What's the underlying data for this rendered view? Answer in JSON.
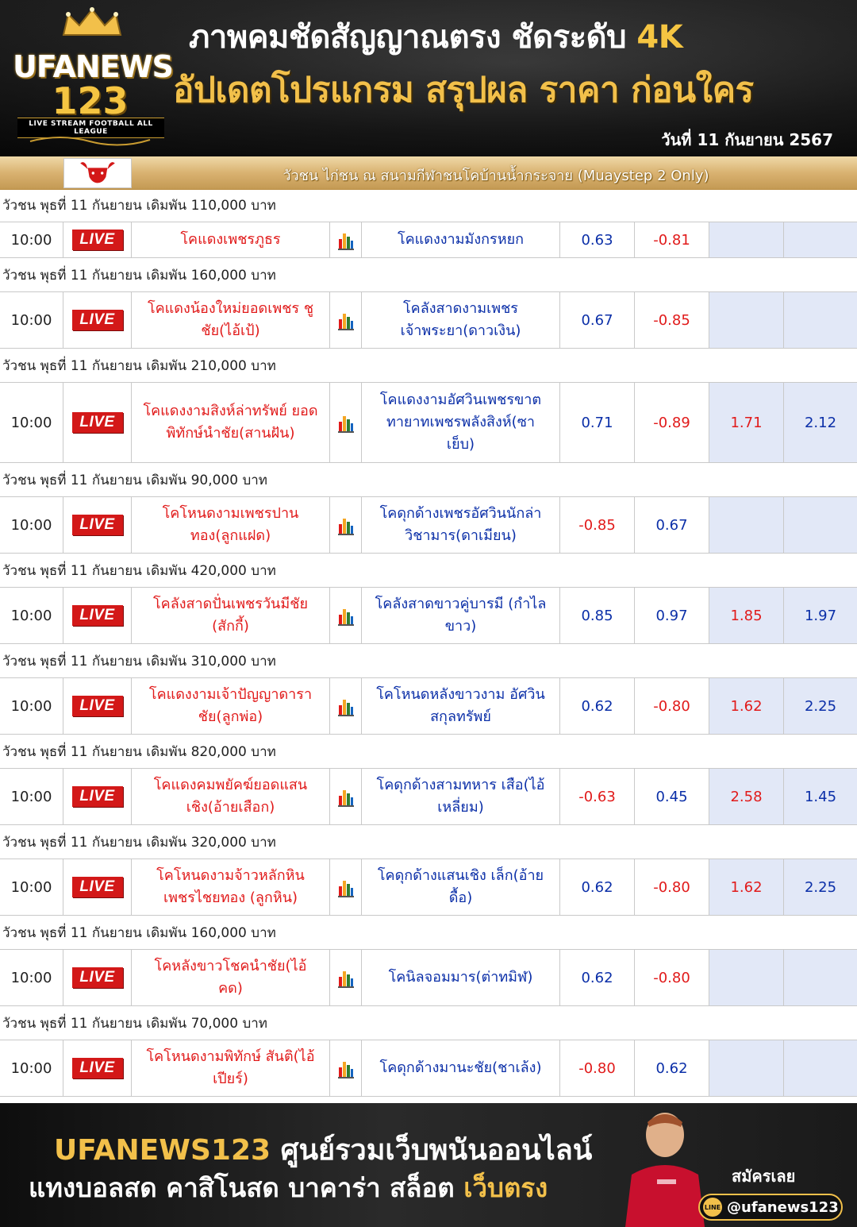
{
  "header": {
    "logo_brand": "UFANEWS",
    "logo_number": "123",
    "logo_tagline": "LIVE STREAM FOOTBALL ALL LEAGUE",
    "headline1_main": "ภาพคมชัดสัญญาณตรง ชัดระดับ ",
    "headline1_highlight": "4K",
    "headline2": "อัปเดตโปรแกรม สรุปผล ราคา ก่อนใคร",
    "date": "วันที่ 11 กันยายน 2567"
  },
  "league": {
    "title": "วัวชน ไก่ชน ณ สนามกีฬาชนโคบ้านน้ำกระจาย (Muaystep 2 Only)"
  },
  "matches": [
    {
      "group": "วัวชน พุธที่ 11 กันยายน เดิมพัน 110,000 บาท",
      "time": "10:00",
      "live": "LIVE",
      "home": "โคแดงเพชรภูธร",
      "away": "โคแดงงามมังกรหยก",
      "o1": "0.63",
      "o2": "-0.81",
      "o3": "",
      "o4": ""
    },
    {
      "group": "วัวชน พุธที่ 11 กันยายน เดิมพัน 160,000 บาท",
      "time": "10:00",
      "live": "LIVE",
      "home": "โคแดงน้องใหม่ยอดเพชร ชูชัย(ไอ้เป้)",
      "away": "โคลังสาดงามเพชร เจ้าพระยา(ดาวเงิน)",
      "o1": "0.67",
      "o2": "-0.85",
      "o3": "",
      "o4": ""
    },
    {
      "group": "วัวชน พุธที่ 11 กันยายน เดิมพัน 210,000 บาท",
      "time": "10:00",
      "live": "LIVE",
      "home": "โคแดงงามสิงห์ล่าทรัพย์ ยอดพิทักษ์นำชัย(สานฝัน)",
      "away": "โคแดงงามอัศวินเพชรขาต ทายาทเพชรพลังสิงห์(ซา เย็บ)",
      "o1": "0.71",
      "o2": "-0.89",
      "o3": "1.71",
      "o4": "2.12"
    },
    {
      "group": "วัวชน พุธที่ 11 กันยายน เดิมพัน 90,000 บาท",
      "time": "10:00",
      "live": "LIVE",
      "home": "โคโหนดงามเพชรปาน ทอง(ลูกแฝด)",
      "away": "โคดุกด้างเพชรอัศวินนักล่า วิชามาร(ดาเมียน)",
      "o1": "-0.85",
      "o2": "0.67",
      "o3": "",
      "o4": ""
    },
    {
      "group": "วัวชน พุธที่ 11 กันยายน เดิมพัน 420,000 บาท",
      "time": "10:00",
      "live": "LIVE",
      "home": "โคลังสาดปั่นเพชรวันมีชัย (สักกี้)",
      "away": "โคลังสาดขาวคู่บารมี (กำไลขาว)",
      "o1": "0.85",
      "o2": "0.97",
      "o3": "1.85",
      "o4": "1.97"
    },
    {
      "group": "วัวชน พุธที่ 11 กันยายน เดิมพัน 310,000 บาท",
      "time": "10:00",
      "live": "LIVE",
      "home": "โคแดงงามเจ้าปัญญาดารา ชัย(ลูกพ่อ)",
      "away": "โคโหนดหลังขาวงาม อัศวินสกุลทรัพย์",
      "o1": "0.62",
      "o2": "-0.80",
      "o3": "1.62",
      "o4": "2.25"
    },
    {
      "group": "วัวชน พุธที่ 11 กันยายน เดิมพัน 820,000 บาท",
      "time": "10:00",
      "live": "LIVE",
      "home": "โคแดงคมพยัคฆ์ยอดแสน เชิง(อ้ายเสือก)",
      "away": "โคดุกด้างสามทหาร เสือ(ไอ้เหลี่ยม)",
      "o1": "-0.63",
      "o2": "0.45",
      "o3": "2.58",
      "o4": "1.45"
    },
    {
      "group": "วัวชน พุธที่ 11 กันยายน เดิมพัน 320,000 บาท",
      "time": "10:00",
      "live": "LIVE",
      "home": "โคโหนดงามจ้าวหลักหิน เพชรไชยทอง (ลูกหิน)",
      "away": "โคดุกด้างแสนเชิง เล็ก(อ้ายดื้อ)",
      "o1": "0.62",
      "o2": "-0.80",
      "o3": "1.62",
      "o4": "2.25"
    },
    {
      "group": "วัวชน พุธที่ 11 กันยายน เดิมพัน 160,000 บาท",
      "time": "10:00",
      "live": "LIVE",
      "home": "โคหลังขาวโชคนำชัย(ไอ้ คด)",
      "away": "โคนิลจอมมาร(ต่าทมิฬ)",
      "o1": "0.62",
      "o2": "-0.80",
      "o3": "",
      "o4": ""
    },
    {
      "group": "วัวชน พุธที่ 11 กันยายน เดิมพัน 70,000 บาท",
      "time": "10:00",
      "live": "LIVE",
      "home": "โคโหนดงามพิทักษ์ สันติ(ไอ้เปียร์)",
      "away": "โคดุกด้างมานะชัย(ชาเล้ง)",
      "o1": "-0.80",
      "o2": "0.62",
      "o3": "",
      "o4": ""
    }
  ],
  "footer": {
    "line1_brand": "UFANEWS123",
    "line1_rest": " ศูนย์รวมเว็บพนันออนไลน์",
    "line2_main": "แทงบอลสด คาสิโนสด บาคาร่า สล็อต ",
    "line2_highlight": "เว็บตรง",
    "signup": "สมัครเลย",
    "line_id": "@ufanews123"
  },
  "colors": {
    "accent_gold": "#f2c04a",
    "live_red": "#d31818",
    "home_red": "#e11a1a",
    "away_blue": "#0b2fa8"
  },
  "icons": {
    "league": "bull-head-icon",
    "stats": "bar-chart-icon",
    "crown": "crown-icon",
    "line": "line-app-icon"
  }
}
